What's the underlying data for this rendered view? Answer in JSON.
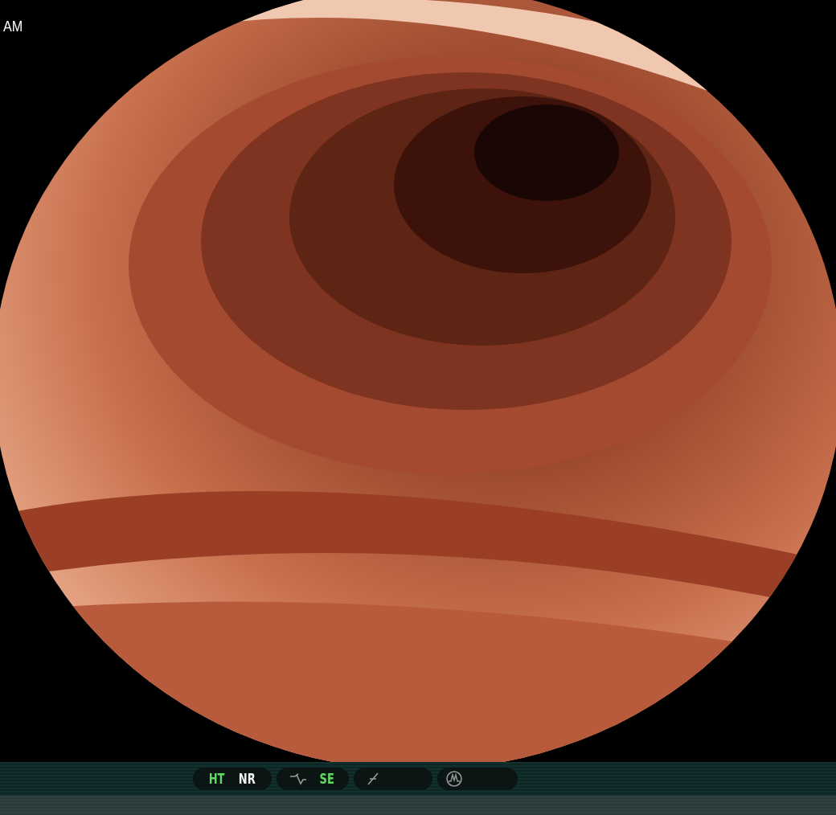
{
  "overlay": {
    "time_suffix": "AM"
  },
  "status_bar": {
    "indicators": [
      {
        "label": "HT",
        "on": true
      },
      {
        "label": "NR",
        "on": false
      },
      {
        "label": "SE",
        "on": true
      }
    ]
  }
}
